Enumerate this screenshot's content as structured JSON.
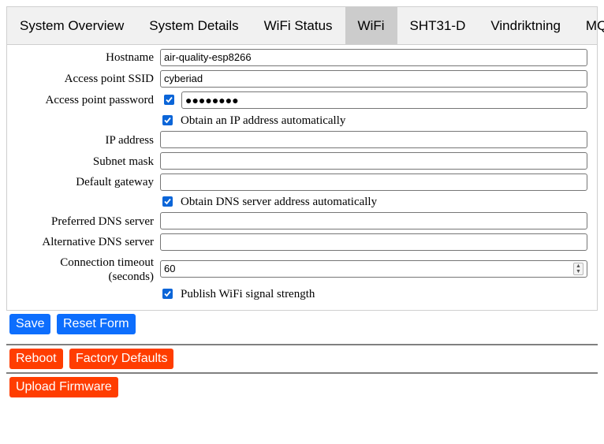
{
  "tabs": [
    {
      "label": "System Overview",
      "active": false
    },
    {
      "label": "System Details",
      "active": false
    },
    {
      "label": "WiFi Status",
      "active": false
    },
    {
      "label": "WiFi",
      "active": true
    },
    {
      "label": "SHT31-D",
      "active": false
    },
    {
      "label": "Vindriktning",
      "active": false
    },
    {
      "label": "MQTT",
      "active": false
    }
  ],
  "form": {
    "hostname": {
      "label": "Hostname",
      "value": "air-quality-esp8266"
    },
    "ssid": {
      "label": "Access point SSID",
      "value": "cyberiad"
    },
    "password": {
      "label": "Access point password",
      "masked_value": "●●●●●●●●",
      "show_checkbox_checked": true
    },
    "dhcp": {
      "label": "Obtain an IP address automatically",
      "checked": true
    },
    "ip": {
      "label": "IP address",
      "value": ""
    },
    "subnet": {
      "label": "Subnet mask",
      "value": ""
    },
    "gateway": {
      "label": "Default gateway",
      "value": ""
    },
    "auto_dns": {
      "label": "Obtain DNS server address automatically",
      "checked": true
    },
    "dns1": {
      "label": "Preferred DNS server",
      "value": ""
    },
    "dns2": {
      "label": "Alternative DNS server",
      "value": ""
    },
    "timeout": {
      "label_line1": "Connection timeout",
      "label_line2": "(seconds)",
      "value": "60"
    },
    "publish_signal": {
      "label": "Publish WiFi signal strength",
      "checked": true
    }
  },
  "buttons": {
    "save": "Save",
    "reset": "Reset Form",
    "reboot": "Reboot",
    "factory": "Factory Defaults",
    "upload": "Upload Firmware"
  },
  "colors": {
    "primary": "#0d6efd",
    "danger": "#ff3d00",
    "checkbox": "#0b65d8",
    "active_tab": "#cccccc"
  }
}
